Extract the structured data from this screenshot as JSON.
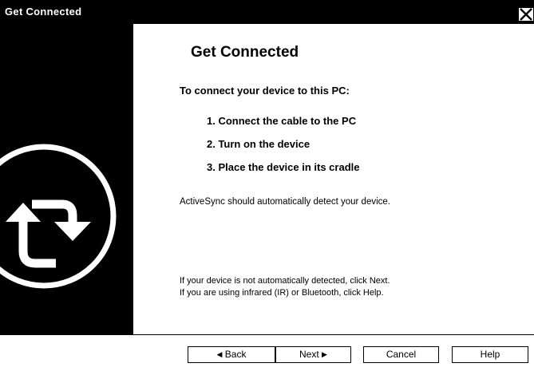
{
  "window": {
    "title": "Get Connected"
  },
  "main": {
    "heading": "Get Connected",
    "intro": "To connect your device to this PC:",
    "steps": [
      "1. Connect the cable to the PC",
      "2. Turn on the device",
      "3. Place the device in its cradle"
    ],
    "detect_text": "ActiveSync should automatically detect your device.",
    "help_lines": [
      "If your device is not automatically detected, click Next.",
      "If you are using infrared (IR) or Bluetooth, click Help."
    ]
  },
  "buttons": {
    "back_label": "Back",
    "next_label": "Next",
    "cancel_label": "Cancel",
    "help_label": "Help"
  },
  "icons": {
    "close": "close-icon",
    "sync": "activesync-logo-icon"
  },
  "colors": {
    "titlebar": "#000000",
    "sidebar": "#000000",
    "background": "#ffffff",
    "text": "#000000"
  }
}
